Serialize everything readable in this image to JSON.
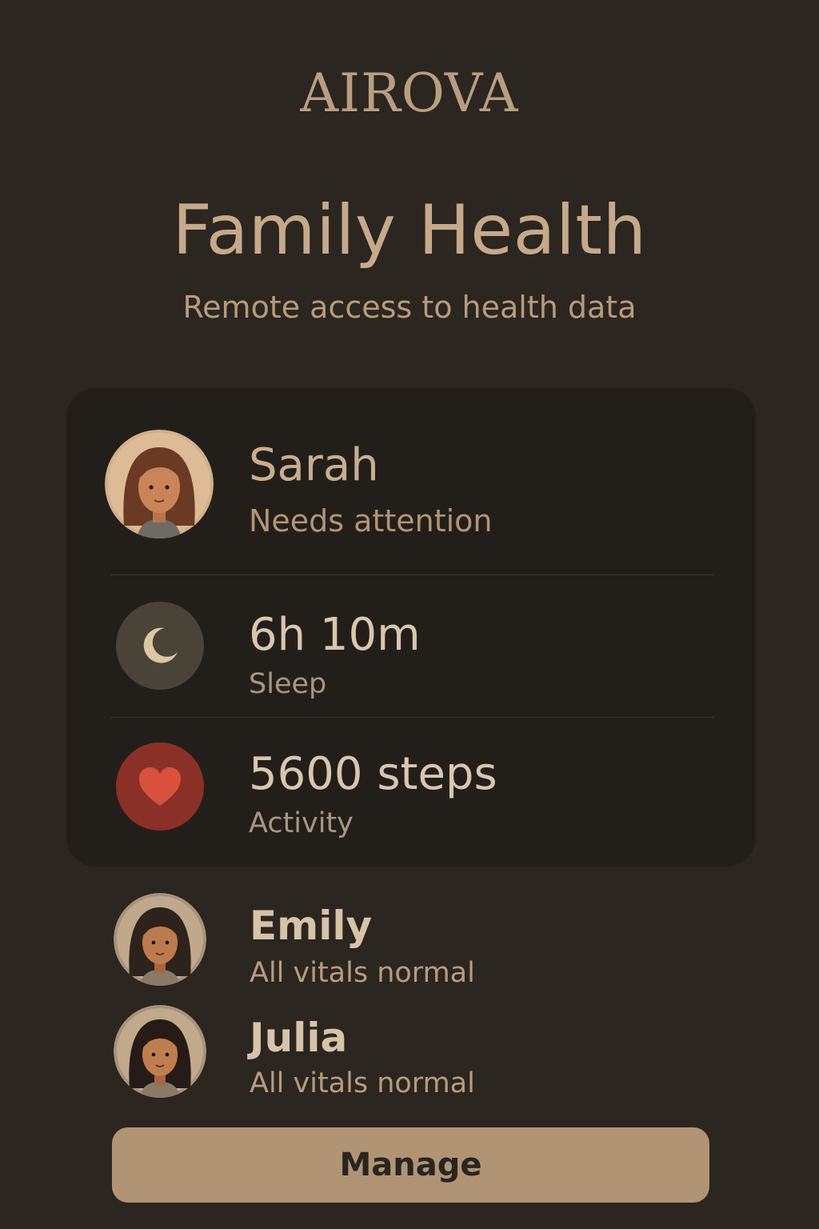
{
  "brand": "AIROVA",
  "header": {
    "title": "Family Health",
    "subtitle": "Remote access to health data"
  },
  "featured_member": {
    "name": "Sarah",
    "status": "Needs attention",
    "metrics": [
      {
        "value": "6h 10m",
        "label": "Sleep",
        "icon": "moon-icon",
        "color": "#4a4338"
      },
      {
        "value": "5600 steps",
        "label": "Activity",
        "icon": "heart-icon",
        "color": "#8a3027"
      }
    ]
  },
  "members": [
    {
      "name": "Emily",
      "status": "All vitals normal"
    },
    {
      "name": "Julia",
      "status": "All vitals normal"
    }
  ],
  "actions": {
    "manage_label": "Manage"
  },
  "colors": {
    "background": "#2b2620",
    "card": "#221f1b",
    "accent": "#b09474",
    "heart": "#d9503d"
  }
}
